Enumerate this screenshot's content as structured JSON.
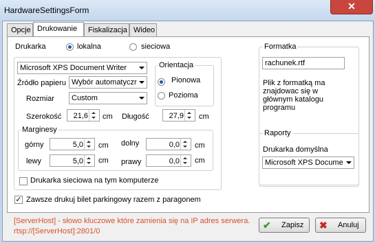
{
  "window": {
    "title": "HardwareSettingsForm",
    "close_glyph": "✕"
  },
  "tabs": [
    "Opcje",
    "Drukowanie",
    "Fiskalizacja",
    "Wideo"
  ],
  "printer": {
    "label": "Drukarka",
    "local_label": "lokalna",
    "network_label": "sieciowa",
    "selected": "lokalna",
    "printer_value": "Microsoft XPS Document Writer",
    "paper_source_label": "Źródło papieru",
    "paper_source_value": "Wybór automatyczr",
    "size_label": "Rozmiar",
    "size_value": "Custom",
    "width_label": "Szerokość",
    "width_value": "21,6",
    "length_label": "Długość",
    "length_value": "27,9",
    "unit": "cm"
  },
  "orientation": {
    "legend": "Orientacja",
    "portrait_label": "Pionowa",
    "landscape_label": "Pozioma",
    "selected": "Pionowa"
  },
  "margins": {
    "legend": "Marginesy",
    "top_label": "górny",
    "top_value": "5,0",
    "bottom_label": "dolny",
    "bottom_value": "0,0",
    "left_label": "lewy",
    "left_value": "5,0",
    "right_label": "prawy",
    "right_value": "0,0",
    "unit": "cm"
  },
  "network_printer_checkbox": {
    "label": "Drukarka sieciowa na tym komputerze",
    "checked": false
  },
  "always_print_checkbox": {
    "label": "Zawsze drukuj bilet parkingowy razem z paragonem",
    "checked": true,
    "glyph": "✓"
  },
  "format": {
    "legend": "Formatka",
    "file_value": "rachunek.rtf",
    "note": "Plik z formatką ma znajdowac się w głównym katalogu programu"
  },
  "reports": {
    "legend": "Raporty",
    "default_printer_label": "Drukarka domyślna",
    "default_printer_value": "Microsoft XPS Docume"
  },
  "hint": {
    "line1": "[ServerHost] - słowo kluczowe które zamienia się na IP adres serwera.",
    "line2": "rtsp://[ServerHost]:2801/0"
  },
  "buttons": {
    "save_label": "Zapisz",
    "cancel_label": "Anuluj",
    "save_glyph": "✔",
    "cancel_glyph": "✖"
  },
  "colors": {
    "hint": "#d9502c",
    "save_icon": "#3a9a2a",
    "cancel_icon": "#c8281e",
    "close": "#c9463d"
  }
}
